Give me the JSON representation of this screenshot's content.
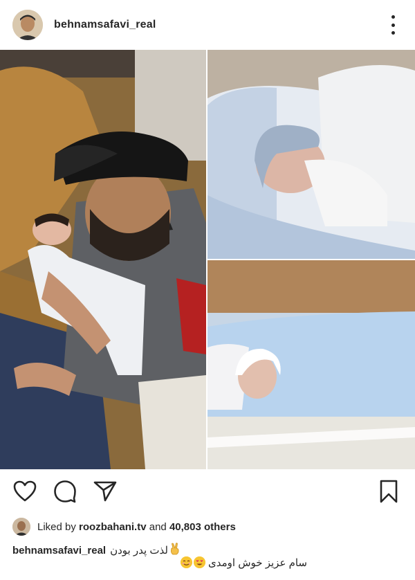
{
  "post": {
    "username": "behnamsafavi_real"
  },
  "likes": {
    "prefix": "Liked by",
    "liker": "roozbahani.tv",
    "connector": "and",
    "others": "40,803 others"
  },
  "caption": {
    "username": "behnamsafavi_real",
    "line1": "لذت پدر بودن",
    "line2": "سام عزیز خوش اومدی"
  },
  "icons": {
    "more": "more-options-icon",
    "like": "heart-icon",
    "comment": "comment-icon",
    "share": "send-icon",
    "save": "bookmark-icon"
  },
  "colors": {
    "text": "#262626",
    "background": "#ffffff",
    "blanket": "#b8d3ee"
  }
}
